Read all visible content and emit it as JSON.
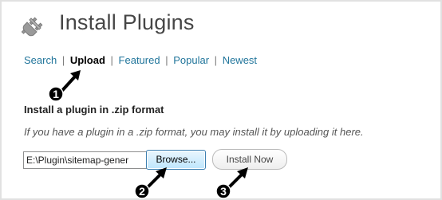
{
  "page": {
    "title": "Install Plugins",
    "icon": "plugin-plug-icon"
  },
  "tabs": [
    {
      "label": "Search",
      "current": false
    },
    {
      "label": "Upload",
      "current": true
    },
    {
      "label": "Featured",
      "current": false
    },
    {
      "label": "Popular",
      "current": false
    },
    {
      "label": "Newest",
      "current": false
    }
  ],
  "tab_separator": "|",
  "upload": {
    "heading": "Install a plugin in .zip format",
    "description": "If you have a plugin in a .zip format, you may install it by uploading it here.",
    "file_value": "E:\\Plugin\\sitemap-gener",
    "browse_label": "Browse...",
    "install_label": "Install Now"
  },
  "callouts": [
    {
      "number": "1",
      "points_to": "Upload tab"
    },
    {
      "number": "2",
      "points_to": "Browse button"
    },
    {
      "number": "3",
      "points_to": "Install Now button"
    }
  ]
}
